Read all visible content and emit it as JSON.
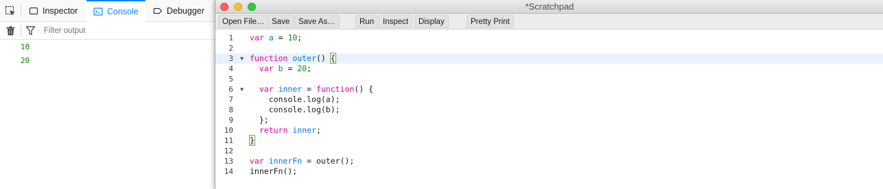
{
  "devtools": {
    "tabs": [
      {
        "label": "Inspector",
        "icon": "inspector-icon"
      },
      {
        "label": "Console",
        "icon": "console-icon",
        "selected": true
      },
      {
        "label": "Debugger",
        "icon": "debugger-icon"
      }
    ],
    "filter_placeholder": "Filter output",
    "output": [
      "10",
      "20"
    ],
    "accent_color": "#0a84ff",
    "output_color": "#058b00"
  },
  "scratchpad": {
    "title": "*Scratchpad",
    "toolbar": {
      "open_file": "Open File…",
      "save": "Save",
      "save_as": "Save As…",
      "run": "Run",
      "inspect": "Inspect",
      "display": "Display",
      "pretty_print": "Pretty Print"
    },
    "gutter": [
      "1",
      "2",
      "3",
      "4",
      "5",
      "6",
      "7",
      "8",
      "9",
      "10",
      "11",
      "12",
      "13",
      "14"
    ],
    "fold_markers": [
      "▼",
      "▼"
    ],
    "code": {
      "l1": {
        "kw": "var",
        "v": "a",
        "op": " = ",
        "num": "10",
        "end": ";"
      },
      "l3": {
        "kw": "function",
        "v": "outer",
        "mid": "() ",
        "brace": "{"
      },
      "l4": {
        "kw": "var",
        "v": "b",
        "op": " = ",
        "num": "20",
        "end": ";"
      },
      "l6": {
        "kw": "var",
        "v": "inner",
        "op": " = ",
        "kw2": "function",
        "end": "() {"
      },
      "l7": "console.log(a);",
      "l8": "console.log(b);",
      "l9": "};",
      "l10": {
        "kw": "return",
        "v": "inner",
        "end": ";"
      },
      "l11": {
        "brace": "}"
      },
      "l13": {
        "kw": "var",
        "v": "innerFn",
        "op": " = ",
        "end": "outer();"
      },
      "l14": "innerFn();"
    }
  }
}
